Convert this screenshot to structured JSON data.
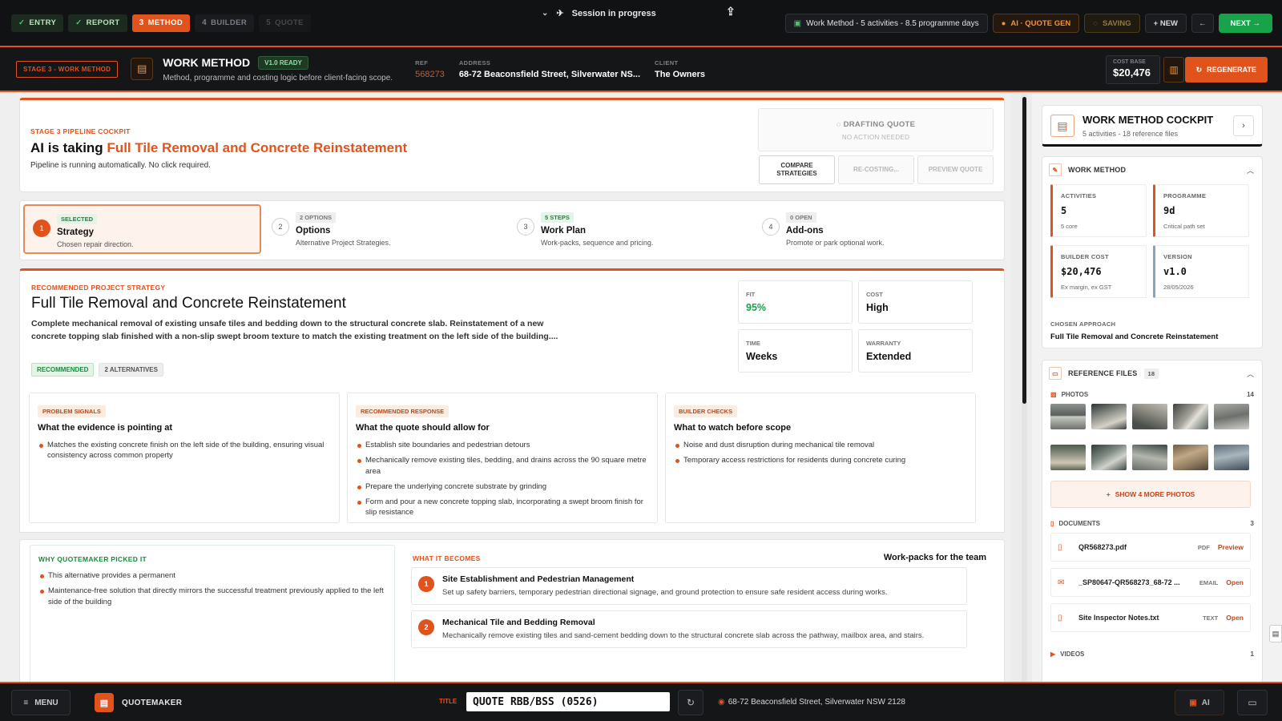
{
  "topbar": {
    "steps": [
      {
        "num": "✓",
        "label": "ENTRY"
      },
      {
        "num": "✓",
        "label": "REPORT"
      },
      {
        "num": "3",
        "label": "METHOD"
      },
      {
        "num": "4",
        "label": "BUILDER"
      },
      {
        "num": "5",
        "label": "QUOTE"
      }
    ],
    "session": "Session in progress",
    "info": "Work Method - 5 activities - 8.5 programme days",
    "ai": "AI · QUOTE GEN",
    "saving": "SAVING",
    "new": "+ NEW",
    "back": "←",
    "next": "NEXT →"
  },
  "stage": {
    "tag": "STAGE 3 - WORK METHOD",
    "title": "WORK METHOD",
    "badge": "V1.0 READY",
    "subtitle": "Method, programme and costing logic before client-facing scope.",
    "ref_label": "REF",
    "ref": "568273",
    "address_label": "ADDRESS",
    "address": "68-72 Beaconsfield Street, Silverwater NS...",
    "client_label": "CLIENT",
    "client": "The Owners",
    "cost_label": "COST BASE",
    "cost": "$20,476",
    "regenerate": "REGENERATE"
  },
  "cockpit": {
    "eyebrow": "STAGE 3 PIPELINE COCKPIT",
    "title_pre": "AI is taking ",
    "title_hl": "Full Tile Removal and Concrete Reinstatement",
    "sub": "Pipeline is running automatically. No click required.",
    "drafting": "DRAFTING QUOTE",
    "drafting_sub": "NO ACTION NEEDED",
    "btn_compare": "COMPARE STRATEGIES",
    "btn_recost": "RE-COSTING...",
    "btn_preview": "PREVIEW QUOTE"
  },
  "tabs": [
    {
      "num": "1",
      "badge": "SELECTED",
      "name": "Strategy",
      "desc": "Chosen repair direction."
    },
    {
      "num": "2",
      "badge": "2 OPTIONS",
      "name": "Options",
      "desc": "Alternative Project Strategies."
    },
    {
      "num": "3",
      "badge": "5 STEPS",
      "name": "Work Plan",
      "desc": "Work-packs, sequence and pricing."
    },
    {
      "num": "4",
      "badge": "0 OPEN",
      "name": "Add-ons",
      "desc": "Promote or park optional work."
    }
  ],
  "strategy": {
    "eyebrow": "RECOMMENDED PROJECT STRATEGY",
    "title": "Full Tile Removal and Concrete Reinstatement",
    "desc": "Complete mechanical removal of existing unsafe tiles and bedding down to the structural concrete slab. Reinstatement of a new concrete topping slab finished with a non-slip swept broom texture to match the existing treatment on the left side of the building....",
    "tag_rec": "RECOMMENDED",
    "tag_alt": "2 ALTERNATIVES",
    "metrics": [
      {
        "k": "FIT",
        "v": "95%"
      },
      {
        "k": "COST",
        "v": "High"
      },
      {
        "k": "TIME",
        "v": "Weeks"
      },
      {
        "k": "WARRANTY",
        "v": "Extended"
      }
    ]
  },
  "columns": [
    {
      "badge": "PROBLEM SIGNALS",
      "head": "What the evidence is pointing at",
      "items": [
        "Matches the existing concrete finish on the left side of the building, ensuring visual consistency across common property"
      ]
    },
    {
      "badge": "RECOMMENDED RESPONSE",
      "head": "What the quote should allow for",
      "items": [
        "Establish site boundaries and pedestrian detours",
        "Mechanically remove existing tiles, bedding, and drains across the 90 square metre area",
        "Prepare the underlying concrete substrate by grinding",
        "Form and pour a new concrete topping slab, incorporating a swept broom finish for slip resistance"
      ]
    },
    {
      "badge": "BUILDER CHECKS",
      "head": "What to watch before scope",
      "items": [
        "Noise and dust disruption during mechanical tile removal",
        "Temporary access restrictions for residents during concrete curing"
      ]
    }
  ],
  "why": {
    "eyebrow": "WHY QUOTEMAKER PICKED IT",
    "items": [
      "This alternative provides a permanent",
      "Maintenance-free solution that directly mirrors the successful treatment previously applied to the left side of the building"
    ]
  },
  "becomes": {
    "eyebrow": "WHAT IT BECOMES",
    "right": "Work-packs for the team",
    "packs": [
      {
        "n": "1",
        "t": "Site Establishment and Pedestrian Management",
        "d": "Set up safety barriers, temporary pedestrian directional signage, and ground protection to ensure safe resident access during works."
      },
      {
        "n": "2",
        "t": "Mechanical Tile and Bedding Removal",
        "d": "Mechanically remove existing tiles and sand-cement bedding down to the structural concrete slab across the pathway, mailbox area, and stairs."
      }
    ]
  },
  "side": {
    "title": "WORK METHOD COCKPIT",
    "sub": "5 activities - 18 reference files",
    "wm_title": "WORK METHOD",
    "stats": [
      {
        "k": "ACTIVITIES",
        "v": "5",
        "s": "5 core"
      },
      {
        "k": "PROGRAMME",
        "v": "9d",
        "s": "Critical path set"
      },
      {
        "k": "BUILDER COST",
        "v": "$20,476",
        "s": "Ex margin, ex GST"
      },
      {
        "k": "VERSION",
        "v": "v1.0",
        "s": "28/05/2026"
      }
    ],
    "approach_k": "CHOSEN APPROACH",
    "approach_v": "Full Tile Removal and Concrete Reinstatement",
    "rf_title": "REFERENCE FILES",
    "rf_count": "18",
    "photos_label": "PHOTOS",
    "photos_count": "14",
    "more_photos": "SHOW 4 MORE PHOTOS",
    "docs_label": "DOCUMENTS",
    "docs_count": "3",
    "docs": [
      {
        "n": "QR568273.pdf",
        "ty": "PDF",
        "a": "Preview"
      },
      {
        "n": "_SP80647-QR568273_68-72 ...",
        "ty": "EMAIL",
        "a": "Open"
      },
      {
        "n": "Site Inspector Notes.txt",
        "ty": "TEXT",
        "a": "Open"
      }
    ],
    "videos_label": "VIDEOS",
    "videos_count": "1"
  },
  "footer": {
    "menu": "MENU",
    "brand": "QUOTEMAKER",
    "title_label": "TITLE",
    "title_value": "QUOTE RBB/BSS (0526)",
    "address": "68-72 Beaconsfield Street, Silverwater NSW 2128",
    "ai": "AI"
  }
}
